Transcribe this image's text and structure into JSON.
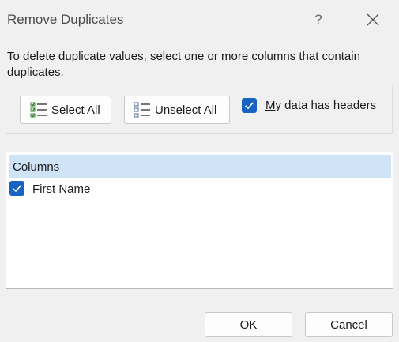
{
  "dialog": {
    "title": "Remove Duplicates",
    "help": "?",
    "instructions": "To delete duplicate values, select one or more columns that contain duplicates."
  },
  "buttons": {
    "select_all": {
      "pre": "Select ",
      "acc": "A",
      "post": "ll"
    },
    "unselect_all": {
      "pre": "",
      "acc": "U",
      "post": "nselect All"
    },
    "ok": "OK",
    "cancel": "Cancel"
  },
  "headers_option": {
    "checked": true,
    "pre": "",
    "acc": "M",
    "post": "y data has headers"
  },
  "columns_list": {
    "header": "Columns",
    "items": [
      {
        "label": "First Name",
        "checked": true
      }
    ]
  },
  "colors": {
    "accent": "#1764c2",
    "list_header_bg": "#cfe4f7"
  }
}
